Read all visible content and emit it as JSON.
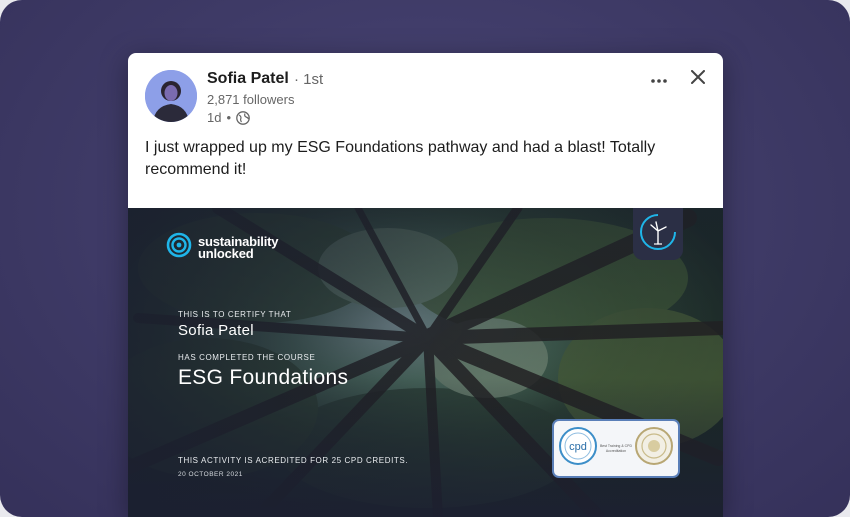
{
  "post": {
    "author_name": "Sofia Patel",
    "connection_degree": "· 1st",
    "followers": "2,871 followers",
    "time_ago": "1d",
    "meta_separator": "•",
    "text": "I just wrapped up my ESG Foundations pathway and had a blast! Totally recommend it!"
  },
  "icons": {
    "more": "more-horizontal-icon",
    "close": "close-icon",
    "globe": "globe-icon"
  },
  "certificate": {
    "brand_line1": "sustainability",
    "brand_line2": "unlocked",
    "certify_label": "THIS IS TO CERTIFY THAT",
    "recipient": "Sofia Patel",
    "completed_label": "HAS COMPLETED THE COURSE",
    "course": "ESG Foundations",
    "credits_text": "THIS ACTIVITY IS ACREDITED FOR 25 CPD CREDITS.",
    "date": "20 OCTOBER 2021",
    "badge_left": "cpd",
    "badge_mid_title": "Best Training & CPD Accreditation"
  },
  "colors": {
    "background": "#3e3a66",
    "accent_cyan": "#1fb5e9"
  }
}
